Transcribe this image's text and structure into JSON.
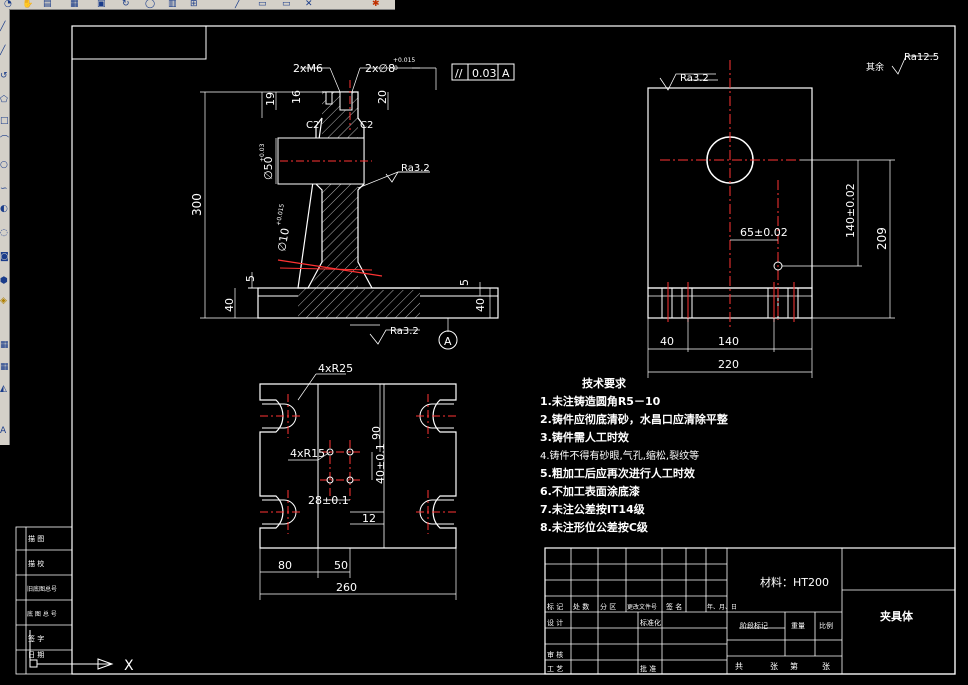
{
  "toolbar": {
    "top_icons": [
      "zoom-icon",
      "pan-icon",
      "layer-icon",
      "grid-icon",
      "snap-icon",
      "orbit-icon",
      "properties-icon",
      "match-icon",
      "line-icon",
      "rect-icon",
      "copy-icon",
      "move-icon",
      "erase-icon",
      "paint-icon"
    ],
    "left_icons": [
      "line-icon",
      "ray-icon",
      "polyline-icon",
      "polygon-icon",
      "rectangle-icon",
      "arc-icon",
      "circle-icon",
      "spline-icon",
      "ellipse-icon",
      "point-icon",
      "insert-icon",
      "hatch-icon",
      "region-icon",
      "mtext-icon",
      "table-icon",
      "block-icon",
      "text-icon"
    ]
  },
  "views": {
    "section": {
      "dims": {
        "two_m6": "2xM6",
        "two_phi8": "2x∅8",
        "tol_plus": "+0.015",
        "tol_zero": "0",
        "d19": "19",
        "d16": "16",
        "d20": "20",
        "c2_left": "C2",
        "c2_right": "C2",
        "phi50": "∅50",
        "tol_phi50": "+0.03",
        "d300": "300",
        "phi10": "∅10",
        "tol_phi10": "+0.015",
        "d5_left": "5",
        "d5_right": "5",
        "d40_left": "40",
        "d40_right": "40"
      },
      "roughness_1": "Ra3.2",
      "roughness_2": "Ra3.2",
      "tolerance_frame": {
        "symbol": "//",
        "value": "0.03",
        "datum": "A"
      },
      "datum_label": "A"
    },
    "side": {
      "roughness": "Ra3.2",
      "other_label": "其余",
      "other_roughness": "Ra12.5",
      "dims": {
        "d65": "65±0.02",
        "d140v": "140±0.02",
        "d209": "209",
        "d40": "40",
        "d140h": "140",
        "d220": "220"
      }
    },
    "plan": {
      "dims": {
        "r25": "4xR25",
        "r15": "4xR15",
        "d90": "90",
        "d40v": "40±0.1",
        "d28": "28±0.1",
        "d12": "12",
        "d80": "80",
        "d50": "50",
        "d260": "260"
      }
    }
  },
  "tech_requirements": {
    "title": "技术要求",
    "items": [
      "1.未注铸造圆角R5－10",
      "2.铸件应彻底清砂，水昌口应清除平整",
      "3.铸件需人工时效",
      "4.铸件不得有砂眼,气孔,缩松,裂纹等",
      "5.粗加工后应再次进行人工时效",
      "6.不加工表面涂底漆",
      "7.未注公差按IT14级",
      "8.未注形位公差按C级"
    ]
  },
  "title_block": {
    "material": "材料：HT200",
    "part_name": "夹具体",
    "row_headers": [
      "标 记",
      "处 数",
      "分 区",
      "更改文件号",
      "签 名",
      "年、月、日"
    ],
    "design": "设 计",
    "standardize": "标准化",
    "stage_mark": "阶段标记",
    "weight": "重量",
    "scale": "比例",
    "review": "审 核",
    "process": "工 艺",
    "approve": "批 准",
    "sheets": [
      "共",
      "张",
      "第",
      "张"
    ]
  },
  "side_table": [
    "描 图",
    "描 校",
    "旧底图总号",
    "底 图 总 号",
    "签 字",
    "日 期"
  ],
  "ucs": {
    "x_label": "X"
  }
}
